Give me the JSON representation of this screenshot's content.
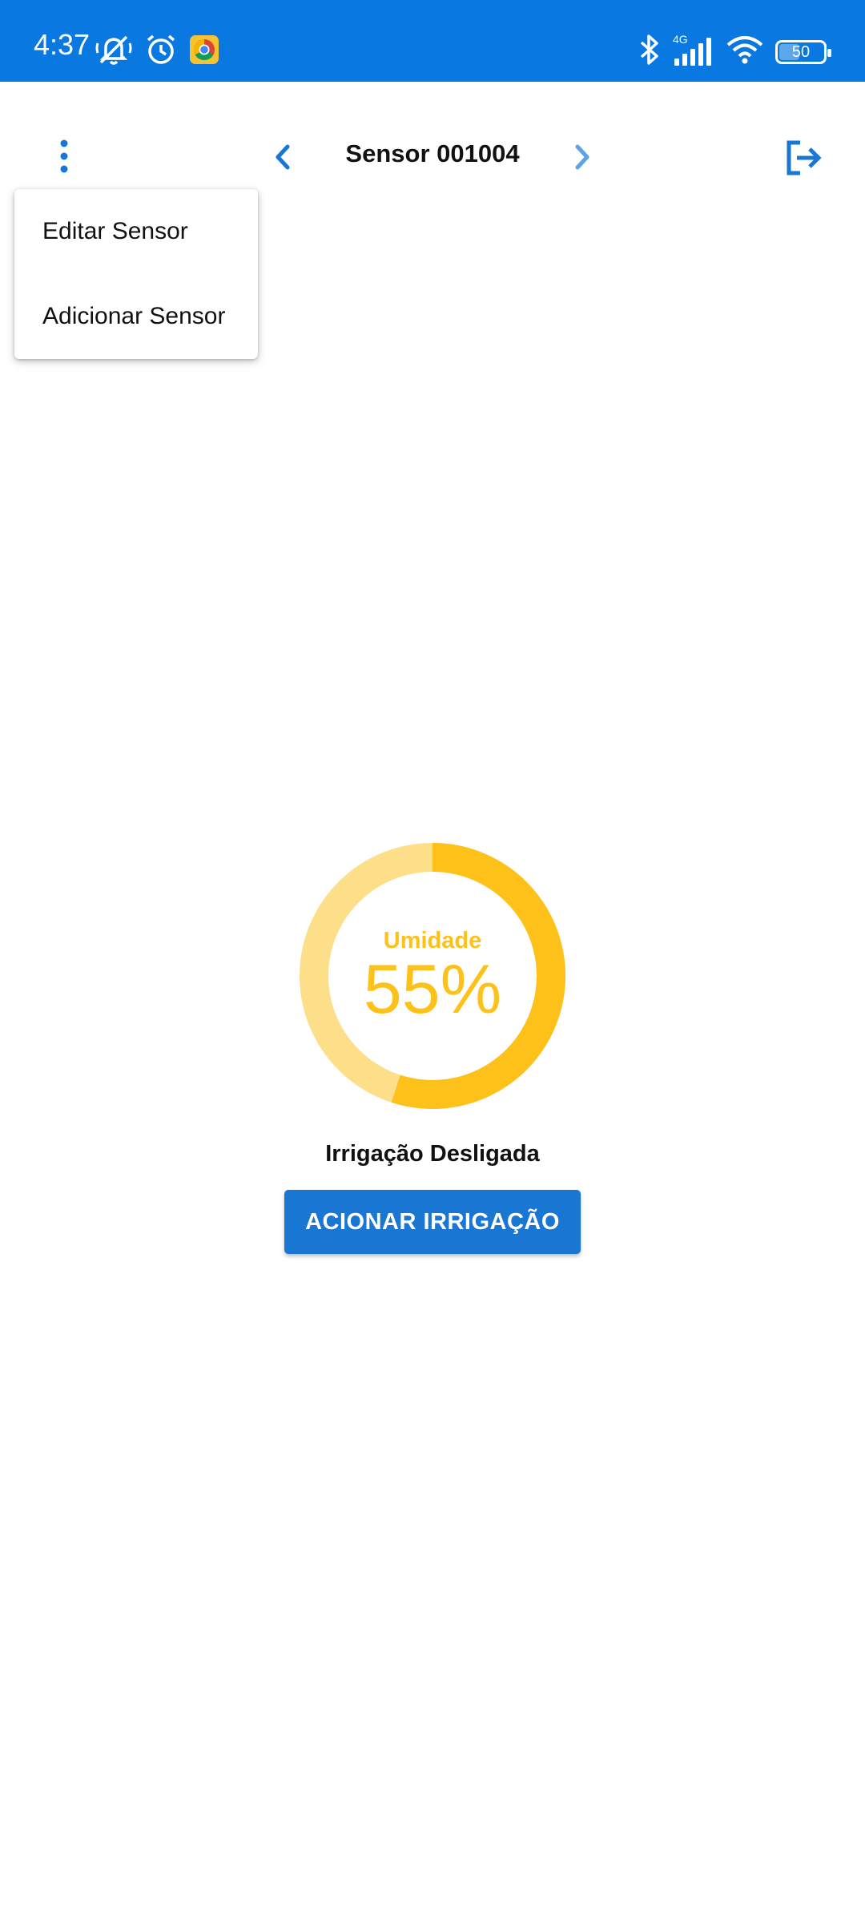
{
  "status_bar": {
    "time": "4:37",
    "network_label": "4G",
    "battery": "50",
    "battery_level": 0.5,
    "icons": [
      "notifications-off-icon",
      "alarm-icon",
      "chrome-icon",
      "bluetooth-icon",
      "signal-icon",
      "wifi-icon",
      "battery-icon"
    ]
  },
  "toolbar": {
    "title": "Sensor 001004",
    "icons": [
      "more-vert-icon",
      "chevron-left-icon",
      "chevron-right-icon",
      "logout-icon"
    ]
  },
  "menu": {
    "items": [
      {
        "label": "Editar Sensor"
      },
      {
        "label": "Adicionar Sensor"
      }
    ]
  },
  "gauge": {
    "label": "Umidade",
    "value_text": "55%",
    "value": 0.55
  },
  "irrigation": {
    "status": "Irrigação Desligada",
    "button_label": "ACIONAR IRRIGAÇÃO"
  },
  "colors": {
    "status_bar": "#0979E1",
    "primary": "#1976D2",
    "gauge_fill": "#FDC11A",
    "gauge_track": "#FEDF89"
  }
}
